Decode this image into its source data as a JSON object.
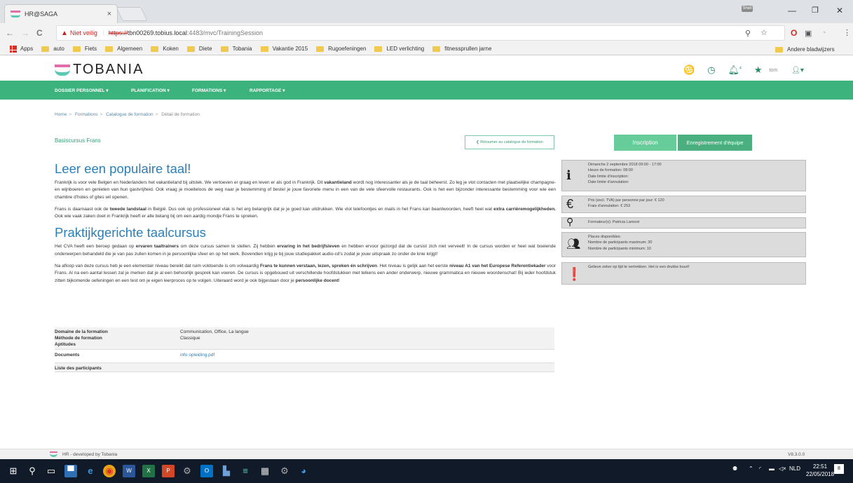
{
  "browser": {
    "tab_title": "HR@SAGA",
    "tab_close": "×",
    "window_user": "Shell",
    "min": "—",
    "max": "❐",
    "close": "✕",
    "back": "←",
    "forward": "→",
    "reload": "C",
    "security_label": "Niet veilig",
    "url_scheme": "https://",
    "url_host": "tbn00269.tobius.local",
    "url_path": ":4483/mvc/TrainingSession",
    "bookmarks": [
      "Apps",
      "auto",
      "Fiets",
      "Algemeen",
      "Koken",
      "Diete",
      "Tobania",
      "Vakantie 2015",
      "Rugoefeningen",
      "LED verlichting",
      "fitnessprullen jarne"
    ],
    "other_bookmarks": "Andere bladwijzers"
  },
  "app": {
    "logo": "TOBANIA",
    "username": "tom",
    "notif_count": "4",
    "nav": [
      "DOSSIER PERSONNEL ▾",
      "PLANIFICATION ▾",
      "FORMATIONS ▾",
      "RAPPORTAGE ▾"
    ]
  },
  "breadcrumb": [
    "Home",
    "Formations",
    "Catalogue de formation",
    "Détail de formation"
  ],
  "page": {
    "training_name": "Basiscursus Frans",
    "back_button": "❮ Retourner au catalogue de formation",
    "inscription": "Inscription",
    "team_registration": "Enregistrement d'équipe",
    "heading1": "Leer een populaire taal!",
    "p1": [
      {
        "t": "Frankrijk is voor vele Belgen en Nederlanders het vakantieland bij uitstek. We vertoeven er graag en leven er als god in Frankrijk. Dit "
      },
      {
        "t": "vakantieland",
        "b": true
      },
      {
        "t": " wordt nog interessanter als je de taal beheerst. Zo leg je vlot contacten met plaatselijke champagne- en wijnboeren en genieten van hun gastvrijheid. Ook vraag je moeiteloos de weg naar je bestemming of bestel je jouw favoriete menu in een van de vele sfeervolle restaurants. Ook is het een bijzonder interessante bestemming voor wie een chambre d'hotes of gites wil openen."
      }
    ],
    "p2": [
      {
        "t": "Frans is daarnaast ook de "
      },
      {
        "t": "tweede landstaal",
        "b": true
      },
      {
        "t": " in België. Dus ook op professioneel vlak is het erg belangrijk dat je je goed kan uitdrukken. Wie vlot telefoontjes en mails in het Frans kan beantwoorden, heeft heel wat "
      },
      {
        "t": "extra carrièremogelijkheden.",
        "b": true
      },
      {
        "t": " Ook wie vaak zaken doet in Frankrijk heeft er alle belang bij om een aardig mondje Frans te spreken."
      }
    ],
    "heading2": "Praktijkgerichte taalcursus",
    "p3": [
      {
        "t": "Het CVA heeft een beroep gedaan op "
      },
      {
        "t": "ervaren taaltrainers",
        "b": true
      },
      {
        "t": " om deze cursus samen te stellen. Zij hebben "
      },
      {
        "t": "ervaring in het bedrijfsleven",
        "b": true
      },
      {
        "t": " en hebben ervoor gezorgd dat de cursist zich niet verveelt! In de cursus worden er heel wat boeiende onderwerpen behandeld die je van pas zullen komen in je persoonlijke sfeer en op het werk. Bovendien krijg je bij jouw studiepakket audio-cd's zodat je jouw uitspraak zo onder de knie krijgt!"
      }
    ],
    "p4": [
      {
        "t": "Na afloop van deze cursus heb je een elementair niveau bereikt dat ruim voldoende is om volwaardig "
      },
      {
        "t": "Frans te kunnen verstaan, lezen, spreken én schrijven",
        "b": true
      },
      {
        "t": ". Het niveau is gelijk aan het eerste "
      },
      {
        "t": "niveau A1 van het Europese Referentiekader",
        "b": true
      },
      {
        "t": " voor Frans. Al na een aantal lessen zal je merken dat je al een behoorlijk gesprek kan voeren. De cursus is opgebouwd uit verschillende hoofdstukken met telkens een ander onderwerp, nieuwe grammatica en nieuwe woordenschat! Bij ieder hoofdstuk zitten bijkomende oefeningen en een test om je eigen leerproces op te volgen. Uiteraard word je ook bijgestaan door je "
      },
      {
        "t": "persoonlijke docent",
        "b": true
      },
      {
        "t": "!"
      }
    ],
    "meta": [
      {
        "k": "Domaine de la formation",
        "v": "Communication, Office, La langue"
      },
      {
        "k": "Méthode de formation",
        "v": "Classique"
      },
      {
        "k": "Aptitudes",
        "v": ""
      }
    ],
    "documents_label": "Documents",
    "documents_link": "info opleiding.pdf",
    "participants_label": "Liste des participants"
  },
  "info": {
    "date_lines": [
      "Dimanche 2 septembre 2018 09:00 - 17:00",
      "Heure de formation: 08:00",
      "Date limite d'inscription:",
      "Date limite d'annulation:"
    ],
    "price_lines": [
      "Prix (excl. TVA) par personne par jour: € 120",
      "Frais d'annulation: € 253"
    ],
    "trainer_line": "Formateur(s): Patricia Lamoot",
    "places_lines": [
      "Places disponibles:",
      "Nombre de participants maximum: 30",
      "Nombre de participants minimum: 10"
    ],
    "note_line": "Gelieve zeker op tijd te vertrekken. Het is een drukke buurt!"
  },
  "footer": {
    "text": "HR - developed by Tobania",
    "version": "V8.3.0.0"
  },
  "taskbar": {
    "lang": "NLD",
    "time": "22:51",
    "date": "22/05/2018",
    "notif": "8"
  }
}
